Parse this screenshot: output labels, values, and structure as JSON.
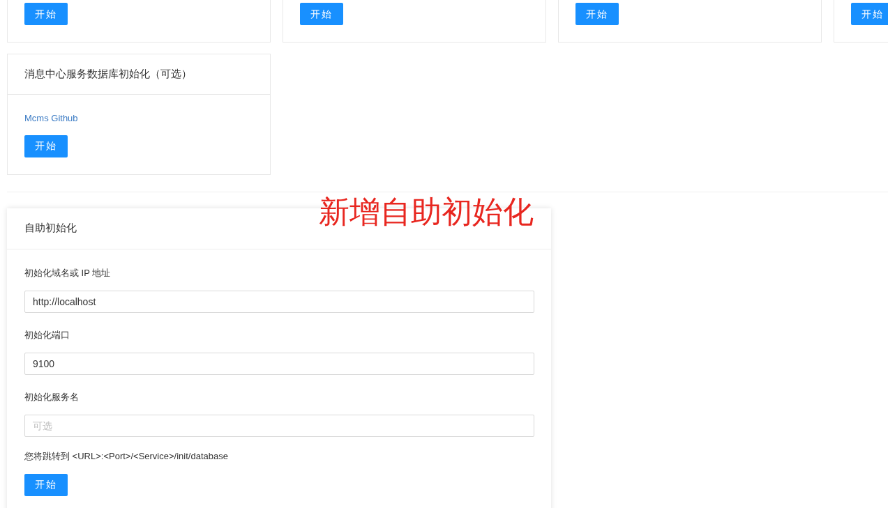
{
  "top_cards": [
    {
      "button": "开始"
    },
    {
      "button": "开始"
    },
    {
      "button": "开始"
    },
    {
      "button": "开始"
    }
  ],
  "mcms_card": {
    "title": "消息中心服务数据库初始化（可选）",
    "link": "Mcms Github",
    "button": "开始"
  },
  "annotation": "新增自助初始化",
  "self_init": {
    "title": "自助初始化",
    "fields": [
      {
        "label": "初始化域名或 IP 地址",
        "value": "http://localhost"
      },
      {
        "label": "初始化端口",
        "value": "9100"
      },
      {
        "label": "初始化服务名",
        "placeholder": "可选"
      }
    ],
    "hint": "您将跳转到 <URL>:<Port>/<Service>/init/database",
    "button": "开始"
  }
}
